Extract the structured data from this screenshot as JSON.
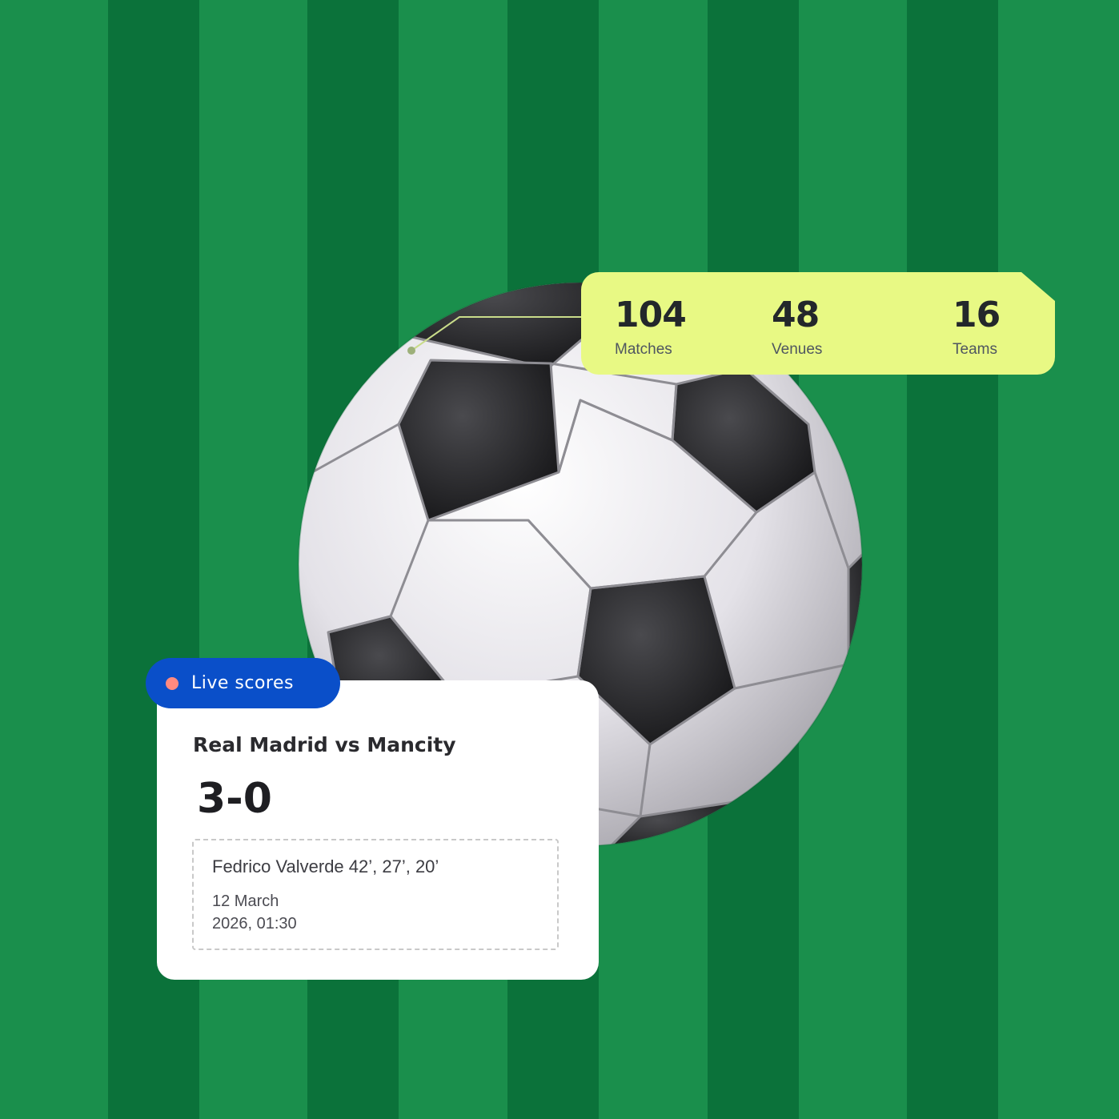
{
  "stats": {
    "matches": {
      "value": "104",
      "label": "Matches"
    },
    "venues": {
      "value": "48",
      "label": "Venues"
    },
    "teams": {
      "value": "16",
      "label": "Teams"
    }
  },
  "live_card": {
    "badge_label": "Live scores",
    "match_title": "Real Madrid vs Mancity",
    "score": "3-0",
    "scorer": "Fedrico Valverde 42’, 27’, 20’",
    "date_line1": "12 March",
    "date_line2": "2026, 01:30"
  },
  "colors": {
    "pitch_light": "#1a8f4c",
    "pitch_dark": "#0b723a",
    "stats_bg": "#e8f984",
    "badge_bg": "#0a4fc9",
    "live_dot": "#ff8a80"
  },
  "icons": {
    "ball": "soccer-ball-icon",
    "live": "live-dot-icon"
  }
}
